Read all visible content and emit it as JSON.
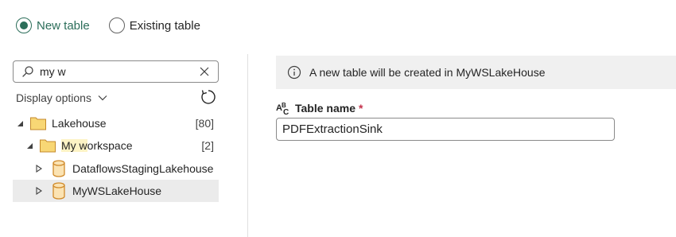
{
  "destination_mode": {
    "options": [
      {
        "label": "New table",
        "checked": true
      },
      {
        "label": "Existing table",
        "checked": false
      }
    ]
  },
  "search": {
    "value": "my w",
    "placeholder": ""
  },
  "display_options": {
    "label": "Display options"
  },
  "tree": {
    "lakehouse": {
      "label": "Lakehouse",
      "count": "[80]"
    },
    "workspace": {
      "label_match": "My w",
      "label_rest": "orkspace",
      "count": "[2]"
    },
    "items": [
      {
        "label": "DataflowsStagingLakehouse"
      },
      {
        "label": "MyWSLakeHouse",
        "selected": true
      }
    ]
  },
  "info": {
    "message": "A new table will be created in MyWSLakeHouse"
  },
  "table_name": {
    "label": "Table name",
    "required_mark": "*",
    "value": "PDFExtractionSink"
  },
  "colors": {
    "accent": "#2c6e5a",
    "folder_fill": "#f8d775",
    "folder_stroke": "#c48a2c",
    "selected_row": "#ebebeb",
    "required": "#c4314b"
  }
}
